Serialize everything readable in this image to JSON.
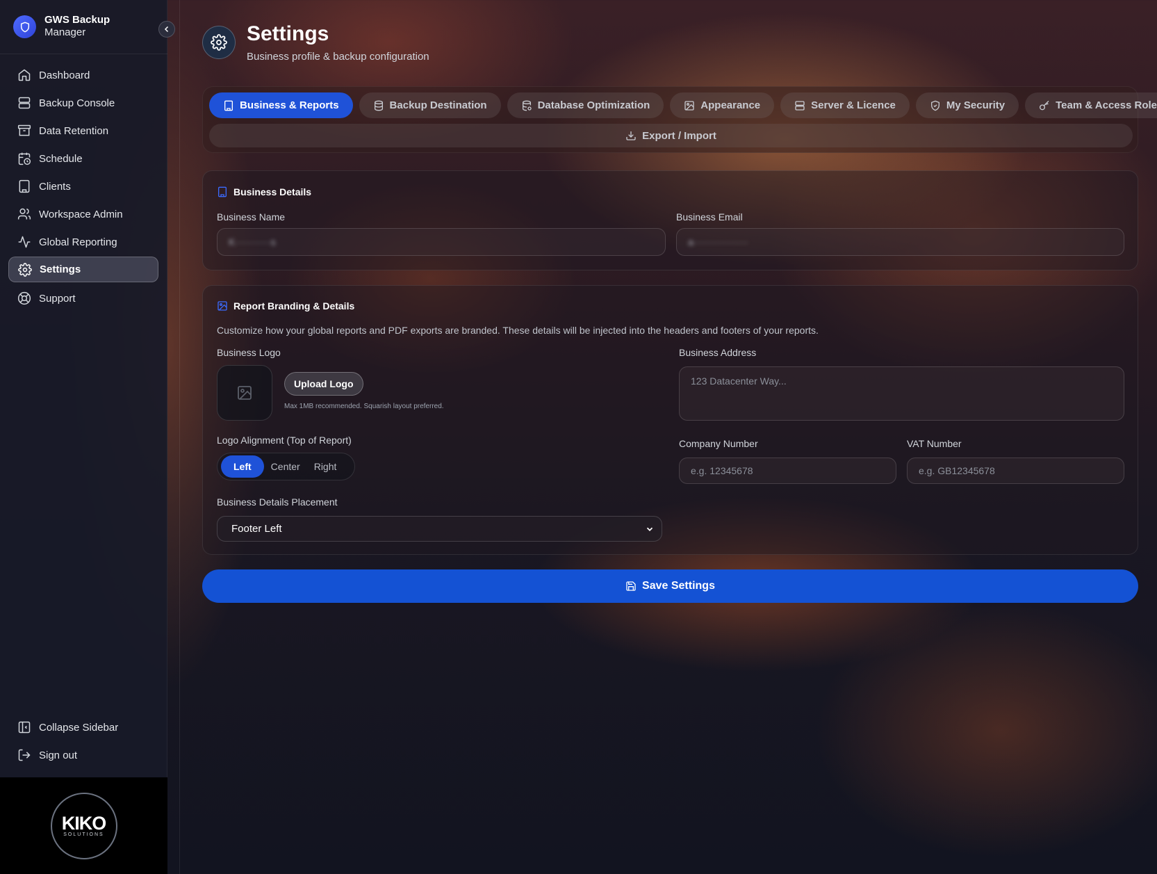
{
  "brand": {
    "title_line1": "GWS Backup",
    "title_line2": "Manager",
    "accent": "#3b5bfd"
  },
  "sidebar": {
    "items": [
      {
        "label": "Dashboard",
        "icon": "home-icon"
      },
      {
        "label": "Backup Console",
        "icon": "server-icon"
      },
      {
        "label": "Data Retention",
        "icon": "archive-icon"
      },
      {
        "label": "Schedule",
        "icon": "calendar-clock-icon"
      },
      {
        "label": "Clients",
        "icon": "building-icon"
      },
      {
        "label": "Workspace Admin",
        "icon": "users-icon"
      },
      {
        "label": "Global Reporting",
        "icon": "activity-icon"
      },
      {
        "label": "Settings",
        "icon": "gear-icon",
        "active": true
      },
      {
        "label": "Support",
        "icon": "lifebuoy-icon"
      }
    ],
    "bottom": [
      {
        "label": "Collapse Sidebar",
        "icon": "panel-left-icon"
      },
      {
        "label": "Sign out",
        "icon": "log-out-icon"
      }
    ],
    "footer_logo": {
      "name": "KIKO",
      "tagline": "SOLUTIONS"
    }
  },
  "header": {
    "title": "Settings",
    "subtitle": "Business profile & backup configuration"
  },
  "tabs": [
    {
      "label": "Business & Reports",
      "icon": "building-icon",
      "active": true
    },
    {
      "label": "Backup Destination",
      "icon": "database-icon"
    },
    {
      "label": "Database Optimization",
      "icon": "database-settings-icon"
    },
    {
      "label": "Appearance",
      "icon": "image-icon"
    },
    {
      "label": "Server & Licence",
      "icon": "server-icon"
    },
    {
      "label": "My Security",
      "icon": "shield-icon"
    },
    {
      "label": "Team & Access Roles",
      "icon": "key-icon"
    }
  ],
  "export_tab": {
    "label": "Export / Import",
    "icon": "download-icon"
  },
  "business_details": {
    "title": "Business Details",
    "name_label": "Business Name",
    "name_value": "K···········s",
    "email_label": "Business Email",
    "email_value": "a·················"
  },
  "report_branding": {
    "title": "Report Branding & Details",
    "description": "Customize how your global reports and PDF exports are branded. These details will be injected into the headers and footers of your reports.",
    "logo_label": "Business Logo",
    "upload_button": "Upload Logo",
    "upload_note": "Max 1MB recommended. Squarish layout preferred.",
    "alignment_label": "Logo Alignment (Top of Report)",
    "alignment_options": [
      "Left",
      "Center",
      "Right"
    ],
    "alignment_selected": "Left",
    "placement_label": "Business Details Placement",
    "placement_value": "Footer Left",
    "address_label": "Business Address",
    "address_placeholder": "123 Datacenter Way...",
    "company_number_label": "Company Number",
    "company_number_placeholder": "e.g. 12345678",
    "vat_number_label": "VAT Number",
    "vat_number_placeholder": "e.g. GB12345678"
  },
  "save_button": {
    "label": "Save Settings",
    "color": "#1452d4"
  }
}
